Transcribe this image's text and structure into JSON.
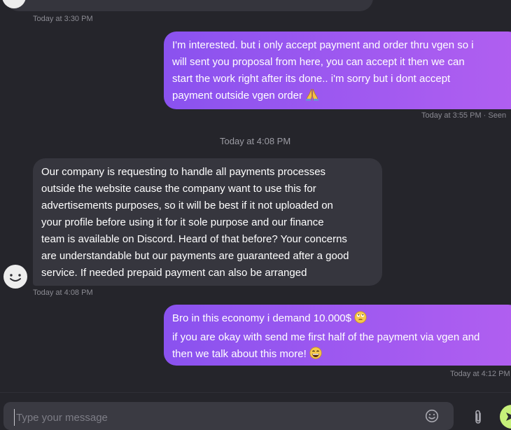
{
  "messages": [
    {
      "direction": "outgoing",
      "lines": [
        "I'm interested. but i only accept payment and order thru vgen so i",
        "will sent you proposal from here, you can accept it then we can",
        "start the work right after its done.. i'm sorry but i dont accept",
        "payment outside vgen order"
      ],
      "emoji": "folded-hands",
      "timestamp": "Today at 3:55 PM · Seen"
    },
    {
      "direction": "incoming",
      "lines": [
        "Our company is requesting to handle all payments processes",
        "outside the website cause the company want to use this for",
        "advertisements purposes, so it will be best if it not uploaded on",
        "your profile before using it for it sole purpose and our finance",
        "team is available on Discord. Heard of that before? Your concerns",
        "are understandable but our payments are guaranteed after a good",
        "service. If needed prepaid payment can also be arranged"
      ],
      "timestamp": "Today at 4:08 PM"
    },
    {
      "direction": "outgoing",
      "lines": [
        "Bro in this economy i demand 10.000$",
        "if you are okay with send me first half of the payment via vgen and",
        "then we talk about this more!"
      ],
      "emojis": [
        "face-with-rolling-eyes",
        "grinning-face"
      ],
      "timestamp": "Today at 4:12 PM"
    }
  ],
  "previous_message_timestamp": "Today at 3:30 PM",
  "date_divider": "Today at 4:08 PM",
  "composer": {
    "placeholder": "Type your message"
  },
  "icons": {
    "emoji_picker": "smiley-icon",
    "attach": "paperclip-icon",
    "send": "send-icon"
  },
  "colors": {
    "background": "#25252b",
    "incoming_bubble": "#36363e",
    "outgoing_bubble_start": "#8a52ef",
    "outgoing_bubble_end": "#b15ff0",
    "send_button": "#c7f07a"
  }
}
